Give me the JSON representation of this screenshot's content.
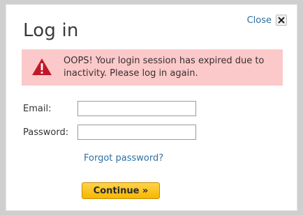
{
  "dialog": {
    "title": "Log in",
    "close_label": "Close",
    "close_icon": "close-x-icon"
  },
  "alert": {
    "icon": "warning-triangle-icon",
    "message": "OOPS! Your login session has expired due to inactivity. Please log in again.",
    "colors": {
      "background": "#fbc9c9",
      "icon": "#c0182a"
    }
  },
  "form": {
    "email_label": "Email:",
    "email_value": "",
    "password_label": "Password:",
    "password_value": "",
    "forgot_link": "Forgot password?",
    "continue_label": "Continue »"
  },
  "colors": {
    "link": "#2f6f9f",
    "button": "#f5b800"
  }
}
